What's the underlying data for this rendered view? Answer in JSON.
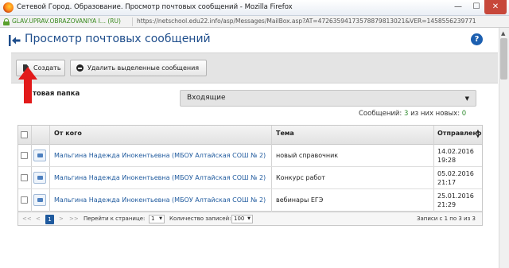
{
  "window": {
    "title": "Сетевой Город. Образование. Просмотр почтовых сообщений - Mozilla Firefox",
    "min_glyph": "—",
    "max_glyph": "☐",
    "close_glyph": "✕"
  },
  "urlbar": {
    "site_identity": "GLAV.UPRAV.OBRAZOVANIYA I... (RU)",
    "url": "https://netschool.edu22.info/asp/Messages/MailBox.asp?AT=47263594173578879813021&VER=1458556239771"
  },
  "page": {
    "title": "Просмотр почтовых сообщений",
    "help_label": "?"
  },
  "toolbar": {
    "create_label": "Создать",
    "delete_label": "Удалить выделенные сообщения"
  },
  "folder": {
    "label": "Почтовая папка",
    "label_visible": "товая папка",
    "selected": "Входящие",
    "arrow_glyph": "▼"
  },
  "counts": {
    "messages_label": "Сообщений:",
    "messages_value": "3",
    "new_label": "из них новых:",
    "new_value": "0"
  },
  "table": {
    "headers": {
      "from": "От кого",
      "subject": "Тема",
      "sent": "Отправлено"
    },
    "rows": [
      {
        "from": "Мальгина Надежда Инокентьевна (МБОУ Алтайская СОШ № 2)",
        "subject": "новый справочник",
        "date": "14.02.2016",
        "time": "19:28"
      },
      {
        "from": "Мальгина Надежда Инокентьевна (МБОУ Алтайская СОШ № 2)",
        "subject": "Конкурс работ",
        "date": "05.02.2016",
        "time": "21:17"
      },
      {
        "from": "Мальгина Надежда Инокентьевна (МБОУ Алтайская СОШ № 2)",
        "subject": "вебинары ЕГЭ",
        "date": "25.01.2016",
        "time": "21:29"
      }
    ]
  },
  "pager": {
    "first": "<<",
    "prev": "<",
    "current_page": "1",
    "next": ">",
    "last": ">>",
    "goto_label": "Перейти к странице:",
    "goto_value": "1",
    "count_label": "Количество записей:",
    "count_value": "100",
    "records_text": "Записи с 1 по 3 из 3"
  },
  "colors": {
    "accent": "#1f5a9e",
    "title": "#1f4e8c",
    "new_count": "#2e8b2e",
    "arrow_annotation": "#e21a1a"
  }
}
